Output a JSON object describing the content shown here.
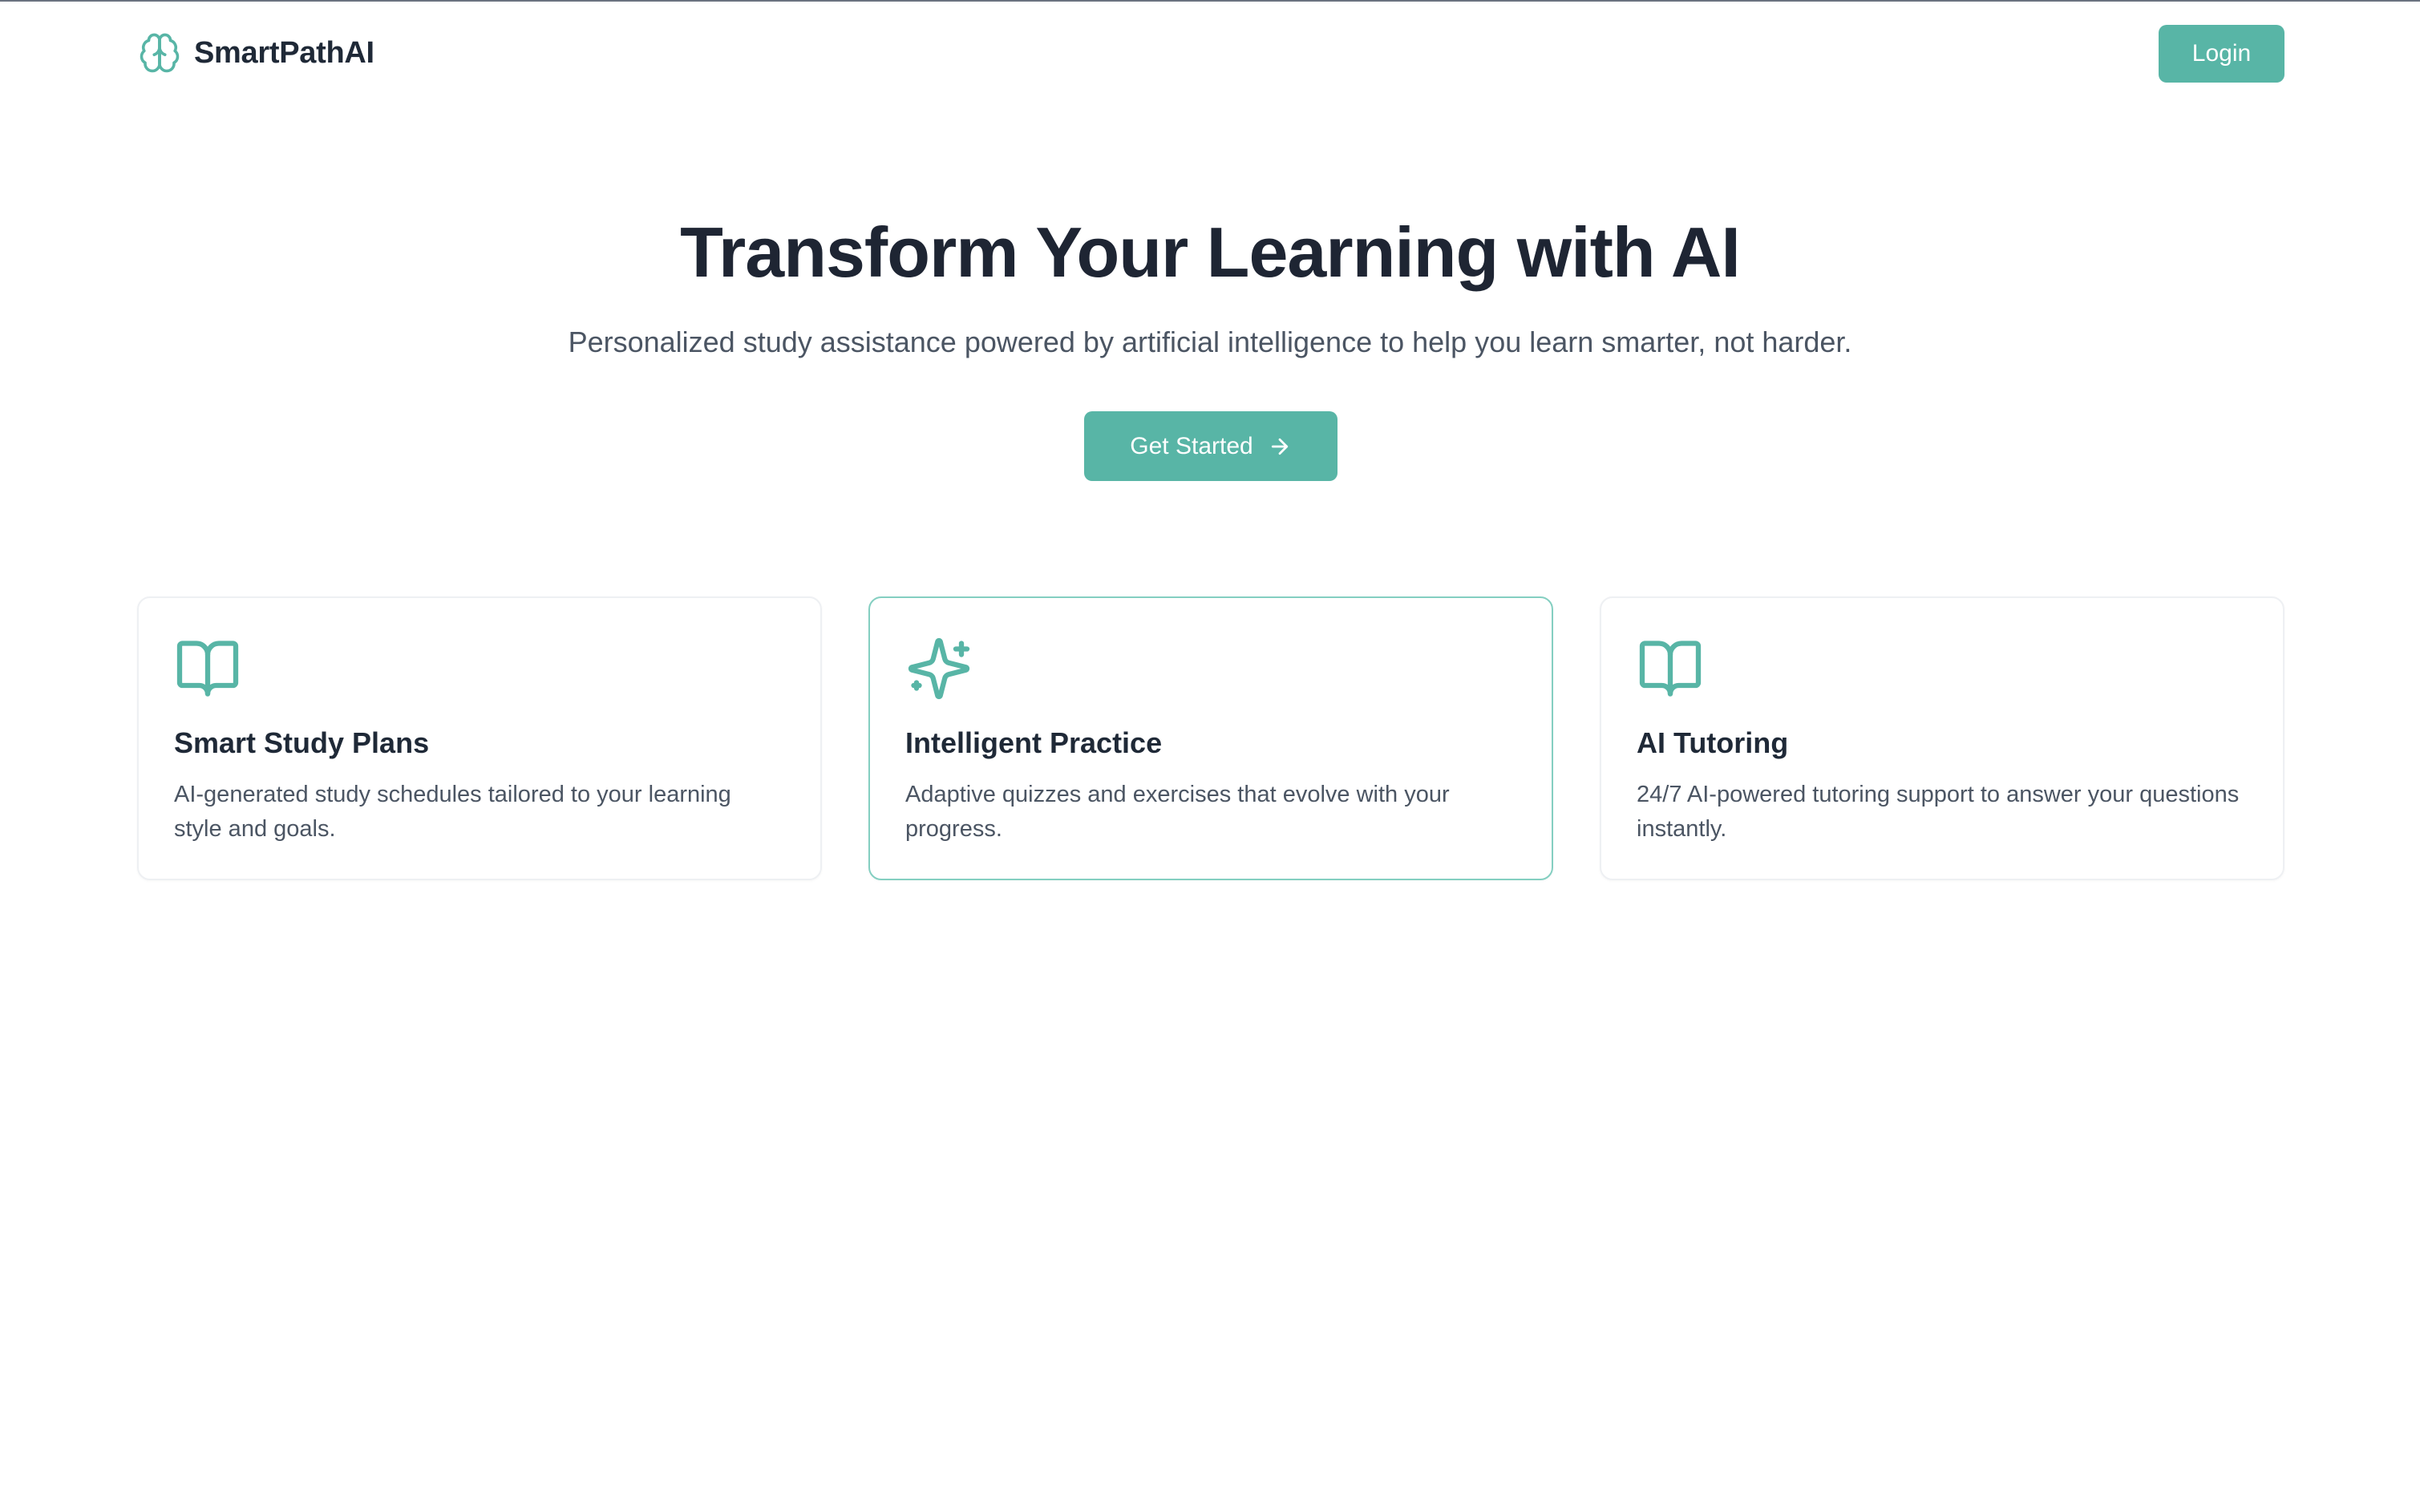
{
  "header": {
    "brand_name": "SmartPathAI",
    "brand_icon": "brain-icon",
    "login_label": "Login"
  },
  "hero": {
    "title": "Transform Your Learning with AI",
    "subtitle": "Personalized study assistance powered by artificial intelligence to help you learn smarter, not harder.",
    "cta_label": "Get Started",
    "cta_icon": "arrow-right-icon"
  },
  "features": [
    {
      "icon": "book-open-icon",
      "title": "Smart Study Plans",
      "description": "AI-generated study schedules tailored to your learning style and goals."
    },
    {
      "icon": "sparkles-icon",
      "title": "Intelligent Practice",
      "description": "Adaptive quizzes and exercises that evolve with your progress."
    },
    {
      "icon": "book-open-icon",
      "title": "AI Tutoring",
      "description": "24/7 AI-powered tutoring support to answer your questions instantly."
    }
  ],
  "colors": {
    "accent": "#58b5a6",
    "active_border": "#84cfc1",
    "heading": "#1e2533",
    "body_text": "#4b5563"
  }
}
